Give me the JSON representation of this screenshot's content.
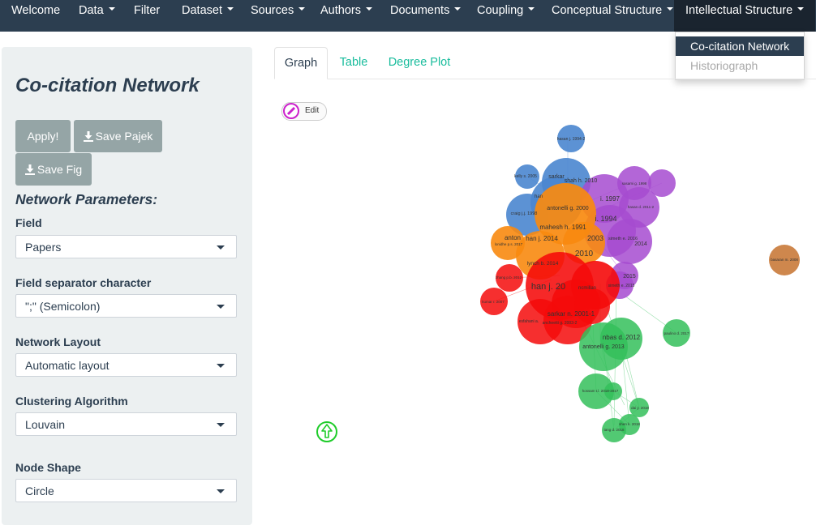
{
  "navbar": {
    "items": [
      {
        "label": "Welcome",
        "caret": false
      },
      {
        "label": "Data",
        "caret": true
      },
      {
        "label": "Filter",
        "caret": false
      },
      {
        "label": "Dataset",
        "caret": true
      },
      {
        "label": "Sources",
        "caret": true
      },
      {
        "label": "Authors",
        "caret": true
      },
      {
        "label": "Documents",
        "caret": true
      },
      {
        "label": "Coupling",
        "caret": true
      },
      {
        "label": "Conceptual Structure",
        "caret": true
      },
      {
        "label": "Intellectual Structure",
        "caret": true,
        "active": true
      }
    ],
    "dropdown": [
      {
        "label": "Co-citation Network",
        "active": true
      },
      {
        "label": "Historiograph",
        "disabled": true
      }
    ]
  },
  "sidebar": {
    "title": "Co-citation Network",
    "buttons": {
      "apply": "Apply!",
      "save_pajek": "Save Pajek",
      "save_fig": "Save Fig"
    },
    "section_title": "Network Parameters:",
    "fields": [
      {
        "label": "Field",
        "value": "Papers"
      },
      {
        "label": "Field separator character",
        "value": "\";\" (Semicolon)"
      },
      {
        "label": "Network Layout",
        "value": "Automatic layout"
      },
      {
        "label": "Clustering Algorithm",
        "value": "Louvain"
      },
      {
        "label": "Node Shape",
        "value": "Circle"
      }
    ]
  },
  "tabs": [
    {
      "label": "Graph",
      "active": true
    },
    {
      "label": "Table"
    },
    {
      "label": "Degree Plot"
    }
  ],
  "graph": {
    "edit_label": "Edit",
    "colors": {
      "blue": "#4a86cf",
      "purple": "#a64bd0",
      "orange": "#f88a0f",
      "red": "#f50a0a",
      "green": "#34c05a",
      "brown": "#c97a3a"
    },
    "node_labels": {
      "hasan_1994": "hasan j. 1994-2",
      "kelly_2005": "kelly s. 2005",
      "sarkar": "sarkar",
      "shah_2010": "shah h. 2010",
      "han": "han",
      "i_1997": "i. 1997",
      "sasami_1998": "sasami g. 1998",
      "craig_1998": "craig j.j. 1998",
      "antonelli_2000": "antonelli g. 2000",
      "hasan_2011": "hasan d. 2011-2",
      "i_1994": "i. 1994",
      "mahesh_1991": "mahesh h. 1991",
      "simeth_2016": "simeth e. 2016",
      "anton": "anton",
      "han_2014": "han j. 2014",
      "y_2003": "2003",
      "y_2014": "2014",
      "lonidhe_2017": "lonidhe p.s. 2017",
      "y_2010": "2010",
      "lynch_2014": "lynch b. 2014",
      "y_2015": "2015",
      "zhang_2012": "zhang p.b. 2012",
      "han_j": "han j. 20",
      "ncmillan": "ncmillan",
      "simeth_2015": "simeth e. 2015",
      "kumar_2007": "kumar r. 2007",
      "sarkar_2001": "sarkar n. 2001-1",
      "esfahani": "esfahani a.",
      "ancheetti_2003": "ancheetti g. 2003-2",
      "abbas_2012": "nbas d. 2012",
      "antonelli_2013": "antonelli g. 2013",
      "paulino_2017": "paulino d. 2017",
      "hossam_2018": "hossam t.l. 2018-2017",
      "dai_2018": "dai y. 2018",
      "shen_2018": "shen k. 2018",
      "tang_2018": "tang d. 2018",
      "basaran_2008": "basaran m. 2008"
    }
  }
}
